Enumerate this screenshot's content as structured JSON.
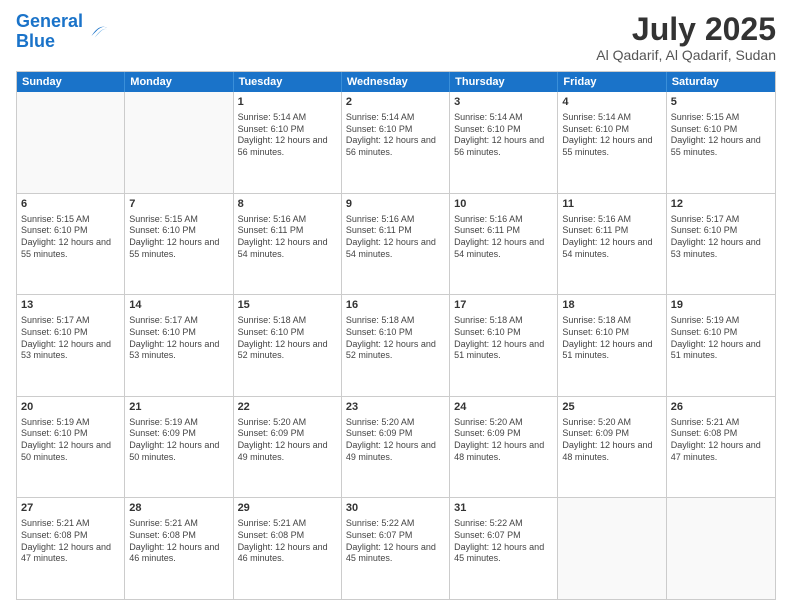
{
  "header": {
    "logo_line1": "General",
    "logo_line2": "Blue",
    "month": "July 2025",
    "location": "Al Qadarif, Al Qadarif, Sudan"
  },
  "days_of_week": [
    "Sunday",
    "Monday",
    "Tuesday",
    "Wednesday",
    "Thursday",
    "Friday",
    "Saturday"
  ],
  "weeks": [
    [
      {
        "day": "",
        "info": ""
      },
      {
        "day": "",
        "info": ""
      },
      {
        "day": "1",
        "info": "Sunrise: 5:14 AM\nSunset: 6:10 PM\nDaylight: 12 hours and 56 minutes."
      },
      {
        "day": "2",
        "info": "Sunrise: 5:14 AM\nSunset: 6:10 PM\nDaylight: 12 hours and 56 minutes."
      },
      {
        "day": "3",
        "info": "Sunrise: 5:14 AM\nSunset: 6:10 PM\nDaylight: 12 hours and 56 minutes."
      },
      {
        "day": "4",
        "info": "Sunrise: 5:14 AM\nSunset: 6:10 PM\nDaylight: 12 hours and 55 minutes."
      },
      {
        "day": "5",
        "info": "Sunrise: 5:15 AM\nSunset: 6:10 PM\nDaylight: 12 hours and 55 minutes."
      }
    ],
    [
      {
        "day": "6",
        "info": "Sunrise: 5:15 AM\nSunset: 6:10 PM\nDaylight: 12 hours and 55 minutes."
      },
      {
        "day": "7",
        "info": "Sunrise: 5:15 AM\nSunset: 6:10 PM\nDaylight: 12 hours and 55 minutes."
      },
      {
        "day": "8",
        "info": "Sunrise: 5:16 AM\nSunset: 6:11 PM\nDaylight: 12 hours and 54 minutes."
      },
      {
        "day": "9",
        "info": "Sunrise: 5:16 AM\nSunset: 6:11 PM\nDaylight: 12 hours and 54 minutes."
      },
      {
        "day": "10",
        "info": "Sunrise: 5:16 AM\nSunset: 6:11 PM\nDaylight: 12 hours and 54 minutes."
      },
      {
        "day": "11",
        "info": "Sunrise: 5:16 AM\nSunset: 6:11 PM\nDaylight: 12 hours and 54 minutes."
      },
      {
        "day": "12",
        "info": "Sunrise: 5:17 AM\nSunset: 6:10 PM\nDaylight: 12 hours and 53 minutes."
      }
    ],
    [
      {
        "day": "13",
        "info": "Sunrise: 5:17 AM\nSunset: 6:10 PM\nDaylight: 12 hours and 53 minutes."
      },
      {
        "day": "14",
        "info": "Sunrise: 5:17 AM\nSunset: 6:10 PM\nDaylight: 12 hours and 53 minutes."
      },
      {
        "day": "15",
        "info": "Sunrise: 5:18 AM\nSunset: 6:10 PM\nDaylight: 12 hours and 52 minutes."
      },
      {
        "day": "16",
        "info": "Sunrise: 5:18 AM\nSunset: 6:10 PM\nDaylight: 12 hours and 52 minutes."
      },
      {
        "day": "17",
        "info": "Sunrise: 5:18 AM\nSunset: 6:10 PM\nDaylight: 12 hours and 51 minutes."
      },
      {
        "day": "18",
        "info": "Sunrise: 5:18 AM\nSunset: 6:10 PM\nDaylight: 12 hours and 51 minutes."
      },
      {
        "day": "19",
        "info": "Sunrise: 5:19 AM\nSunset: 6:10 PM\nDaylight: 12 hours and 51 minutes."
      }
    ],
    [
      {
        "day": "20",
        "info": "Sunrise: 5:19 AM\nSunset: 6:10 PM\nDaylight: 12 hours and 50 minutes."
      },
      {
        "day": "21",
        "info": "Sunrise: 5:19 AM\nSunset: 6:09 PM\nDaylight: 12 hours and 50 minutes."
      },
      {
        "day": "22",
        "info": "Sunrise: 5:20 AM\nSunset: 6:09 PM\nDaylight: 12 hours and 49 minutes."
      },
      {
        "day": "23",
        "info": "Sunrise: 5:20 AM\nSunset: 6:09 PM\nDaylight: 12 hours and 49 minutes."
      },
      {
        "day": "24",
        "info": "Sunrise: 5:20 AM\nSunset: 6:09 PM\nDaylight: 12 hours and 48 minutes."
      },
      {
        "day": "25",
        "info": "Sunrise: 5:20 AM\nSunset: 6:09 PM\nDaylight: 12 hours and 48 minutes."
      },
      {
        "day": "26",
        "info": "Sunrise: 5:21 AM\nSunset: 6:08 PM\nDaylight: 12 hours and 47 minutes."
      }
    ],
    [
      {
        "day": "27",
        "info": "Sunrise: 5:21 AM\nSunset: 6:08 PM\nDaylight: 12 hours and 47 minutes."
      },
      {
        "day": "28",
        "info": "Sunrise: 5:21 AM\nSunset: 6:08 PM\nDaylight: 12 hours and 46 minutes."
      },
      {
        "day": "29",
        "info": "Sunrise: 5:21 AM\nSunset: 6:08 PM\nDaylight: 12 hours and 46 minutes."
      },
      {
        "day": "30",
        "info": "Sunrise: 5:22 AM\nSunset: 6:07 PM\nDaylight: 12 hours and 45 minutes."
      },
      {
        "day": "31",
        "info": "Sunrise: 5:22 AM\nSunset: 6:07 PM\nDaylight: 12 hours and 45 minutes."
      },
      {
        "day": "",
        "info": ""
      },
      {
        "day": "",
        "info": ""
      }
    ]
  ]
}
